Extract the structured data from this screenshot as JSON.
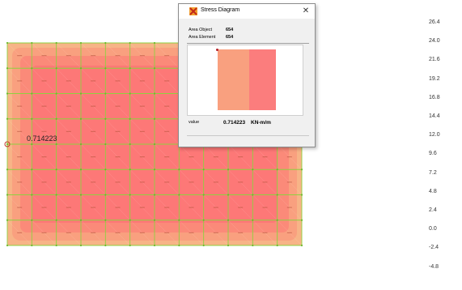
{
  "dialog": {
    "title": "Stress Diagram",
    "area_object_label": "Area Object",
    "area_object_value": "654",
    "area_element_label": "Area Element",
    "area_element_value": "654",
    "value_label": "value",
    "value_number": "0.714223",
    "value_unit": "KN-m/m"
  },
  "model": {
    "point_value": "0.714223"
  },
  "legend": {
    "labels": [
      "26.4",
      "24.0",
      "21.6",
      "19.2",
      "16.8",
      "14.4",
      "12.0",
      "9.6",
      "7.2",
      "4.8",
      "2.4",
      "0.0",
      "-2.4",
      "-4.8"
    ]
  },
  "colors": {
    "plate_edge": "#f7b487",
    "plate_mid": "#fb8a79",
    "plate_center": "#fd7877",
    "mesh_line": "#8ed13f",
    "diagram_left": "#f9a07f",
    "diagram_right": "#fb7d7d"
  }
}
